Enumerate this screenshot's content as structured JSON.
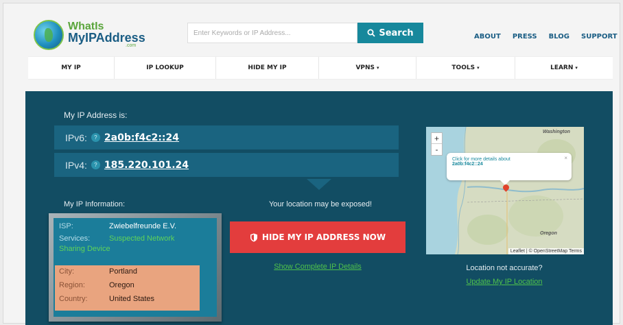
{
  "header": {
    "logo_line1": "WhatIs",
    "logo_line2": "MyIPAddress",
    "logo_suffix": ".com",
    "search_placeholder": "Enter Keywords or IP Address...",
    "search_button": "Search",
    "links": [
      "ABOUT",
      "PRESS",
      "BLOG",
      "SUPPORT"
    ]
  },
  "nav": {
    "items": [
      {
        "label": "MY IP",
        "dropdown": false
      },
      {
        "label": "IP LOOKUP",
        "dropdown": false
      },
      {
        "label": "HIDE MY IP",
        "dropdown": false
      },
      {
        "label": "VPNS",
        "dropdown": true
      },
      {
        "label": "TOOLS",
        "dropdown": true
      },
      {
        "label": "LEARN",
        "dropdown": true
      }
    ],
    "caret": "▾"
  },
  "ip": {
    "heading": "My IP Address is:",
    "ipv6_label": "IPv6:",
    "ipv6_value": "2a0b:f4c2::24",
    "ipv4_label": "IPv4:",
    "ipv4_value": "185.220.101.24",
    "help_glyph": "?"
  },
  "info": {
    "heading": "My IP Information:",
    "isp_label": "ISP:",
    "isp_value": "Zwiebelfreunde E.V.",
    "services_label": "Services:",
    "services_value_1": "Suspected Network",
    "services_value_2": "Sharing Device",
    "city_label": "City:",
    "city_value": "Portland",
    "region_label": "Region:",
    "region_value": "Oregon",
    "country_label": "Country:",
    "country_value": "United States"
  },
  "center": {
    "expose_text": "Your location may be exposed!",
    "hide_button": "HIDE MY IP ADDRESS NOW",
    "details_link": "Show Complete IP Details"
  },
  "map": {
    "zoom_in": "+",
    "zoom_out": "-",
    "popup_line1": "Click for more details about",
    "popup_line2": "2a0b:f4c2::24",
    "popup_close": "×",
    "state_top": "Washington",
    "state_bottom": "Oregon",
    "attribution": "Leaflet | © OpenStreetMap Terms",
    "location_question": "Location not accurate?",
    "update_link": "Update My IP Location"
  },
  "colors": {
    "panel": "#124d63",
    "accent": "#17889c",
    "danger": "#e33d3d",
    "link_green": "#4fc24b",
    "location_bg": "#e9a47f"
  }
}
